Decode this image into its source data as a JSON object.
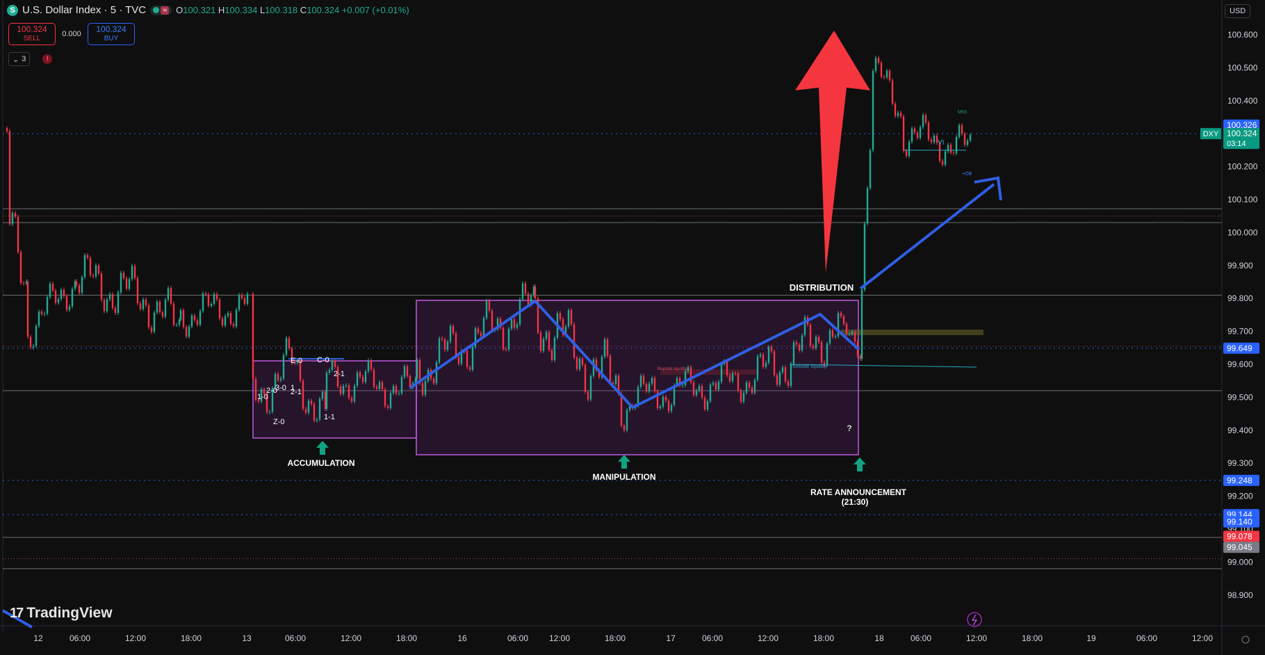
{
  "header": {
    "symbol_icon": "S",
    "title": "U.S. Dollar Index · 5 · TVC",
    "wave_icon": "≈",
    "ohlc": [
      {
        "k": "O",
        "v": "100.321"
      },
      {
        "k": "H",
        "v": "100.334"
      },
      {
        "k": "L",
        "v": "100.318"
      },
      {
        "k": "C",
        "v": "100.324"
      }
    ],
    "change": "+0.007 (+0.01%)"
  },
  "trade": {
    "sell_price": "100.324",
    "sell_label": "SELL",
    "spread": "0.000",
    "buy_price": "100.324",
    "buy_label": "BUY"
  },
  "indicators": {
    "count": "3",
    "error_icon": "!"
  },
  "currency": "USD",
  "brand": "TradingView",
  "colors": {
    "up": "#22ab94",
    "down": "#f23645",
    "accent": "#2962ff",
    "box": "#c15ce0",
    "arrow_red": "#f5363f"
  },
  "chart_data": {
    "type": "candlestick",
    "series": [
      {
        "name": "DXY",
        "last": 100.324
      }
    ],
    "y_ticks": [
      "100.600",
      "100.500",
      "100.400",
      "100.300",
      "100.200",
      "100.100",
      "100.000",
      "99.900",
      "99.800",
      "99.700",
      "99.600",
      "99.500",
      "99.400",
      "99.300",
      "99.200",
      "99.100",
      "99.000",
      "98.900"
    ],
    "x_ticks": [
      "12",
      "06:00",
      "12:00",
      "18:00",
      "13",
      "06:00",
      "12:00",
      "18:00",
      "16",
      "06:00",
      "12:00",
      "18:00",
      "17",
      "06:00",
      "12:00",
      "18:00",
      "18",
      "06:00",
      "12:00",
      "18:00",
      "19",
      "06:00",
      "12:00"
    ],
    "ylim": [
      98.85,
      100.65
    ],
    "price_labels": [
      {
        "text": "100.326",
        "value": 100.326,
        "color": "#2962ff"
      },
      {
        "text": "DXY",
        "value": 100.3,
        "color": "#089981",
        "tag": true
      },
      {
        "text": "100.324",
        "value": 100.3,
        "color": "#089981",
        "time": "03:14"
      },
      {
        "text": "99.649",
        "value": 99.649,
        "color": "#2962ff"
      },
      {
        "text": "99.248",
        "value": 99.248,
        "color": "#2962ff"
      },
      {
        "text": "99.144",
        "value": 99.144,
        "color": "#2962ff"
      },
      {
        "text": "99.140",
        "value": 99.122,
        "color": "#2962ff"
      },
      {
        "text": "99.078",
        "value": 99.078,
        "color": "#f23645"
      },
      {
        "text": "99.045",
        "value": 99.045,
        "color": "#787b86"
      }
    ],
    "annotations": [
      "ACCUMULATION",
      "MANIPULATION",
      "DISTRIBUTION",
      "RATE ANNOUNCEMENT",
      "(21:30)",
      "?",
      "1-0",
      "2-0",
      "3-0",
      "1",
      "2-1",
      "Z-0",
      "1-1",
      "E-0",
      "C-0",
      "2-1",
      "Sellside liquidity",
      "Buyside liquidity",
      "VI",
      "MSS",
      "+OB"
    ]
  }
}
